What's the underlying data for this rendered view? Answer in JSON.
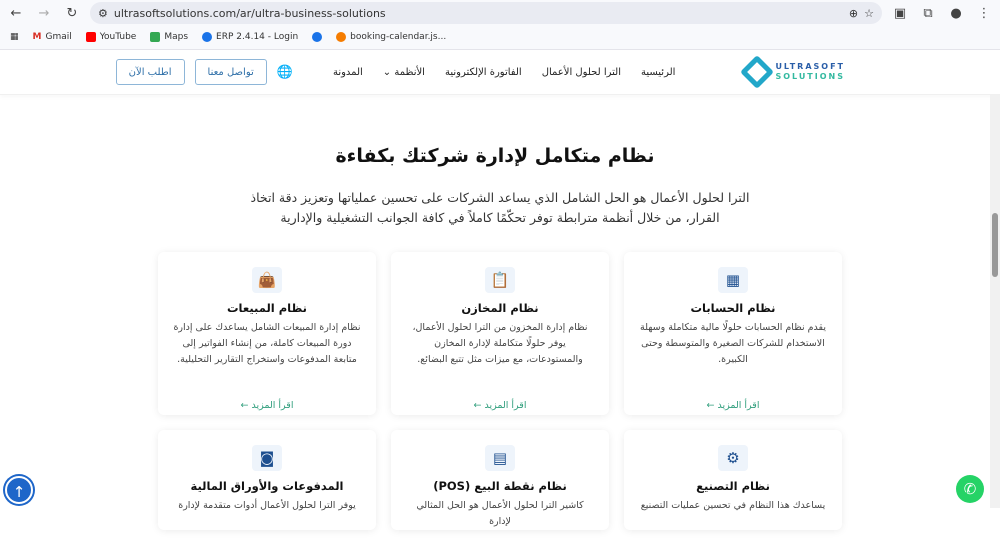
{
  "browser": {
    "url": "ultrasoftsolutions.com/ar/ultra-business-solutions",
    "bookmarks": [
      "Gmail",
      "YouTube",
      "Maps",
      "ERP 2.4.14 - Login",
      "booking-calendar.js..."
    ]
  },
  "header": {
    "logo_top": "ULTRASOFT",
    "logo_bottom": "SOLUTIONS",
    "menu": [
      "الرئيسية",
      "الترا لحلول الأعمال",
      "الفاتورة الإلكترونية",
      "الأنظمة ⌄",
      "المدونة"
    ],
    "contact_button": "تواصل معنا",
    "order_button": "اطلب الآن"
  },
  "main": {
    "title": "نظام متكامل لإدارة شركتك بكفاءة",
    "subtitle": "الترا لحلول الأعمال هو الحل الشامل الذي يساعد الشركات على تحسين عملياتها وتعزيز دقة اتخاذ القرار، من خلال أنظمة مترابطة توفر تحكّمًا كاملاً في كافة الجوانب التشغيلية والإدارية",
    "cards": [
      {
        "icon": "calculator-icon",
        "title": "نظام الحسابات",
        "desc": "يقدم نظام الحسابات حلولًا مالية متكاملة وسهلة الاستخدام للشركات الصغيرة والمتوسطة وحتى الكبيرة.",
        "more": "اقرأ المزيد ←"
      },
      {
        "icon": "clipboard-check-icon",
        "title": "نظام المخازن",
        "desc": "نظام إدارة المخزون من الترا لحلول الأعمال، يوفر حلولًا متكاملة لإدارة المخازن والمستودعات، مع ميزات مثل تتبع البضائع.",
        "more": "اقرأ المزيد ←"
      },
      {
        "icon": "shopping-bag-icon",
        "title": "نظام المبيعات",
        "desc": "نظام إدارة المبيعات الشامل يساعدك على إدارة دورة المبيعات كاملة، من إنشاء الفواتير إلى متابعة المدفوعات واستخراج التقارير التحليلية.",
        "more": "اقرأ المزيد ←"
      },
      {
        "icon": "robot-arm-icon",
        "title": "نظام التصنيع",
        "desc": "يساعدك هذا النظام في تحسين عمليات التصنيع"
      },
      {
        "icon": "cash-register-icon",
        "title": "نظام نقطة البيع (POS)",
        "desc": "كاشير الترا لحلول الأعمال هو الحل المثالي لإدارة"
      },
      {
        "icon": "money-icon",
        "title": "المدفوعات والأوراق المالية",
        "desc": "يوفر الترا لحلول الأعمال أدوات متقدمة لإدارة"
      }
    ]
  },
  "colors": {
    "accent": "#2f9e7c",
    "brand": "#1e4f8f"
  }
}
